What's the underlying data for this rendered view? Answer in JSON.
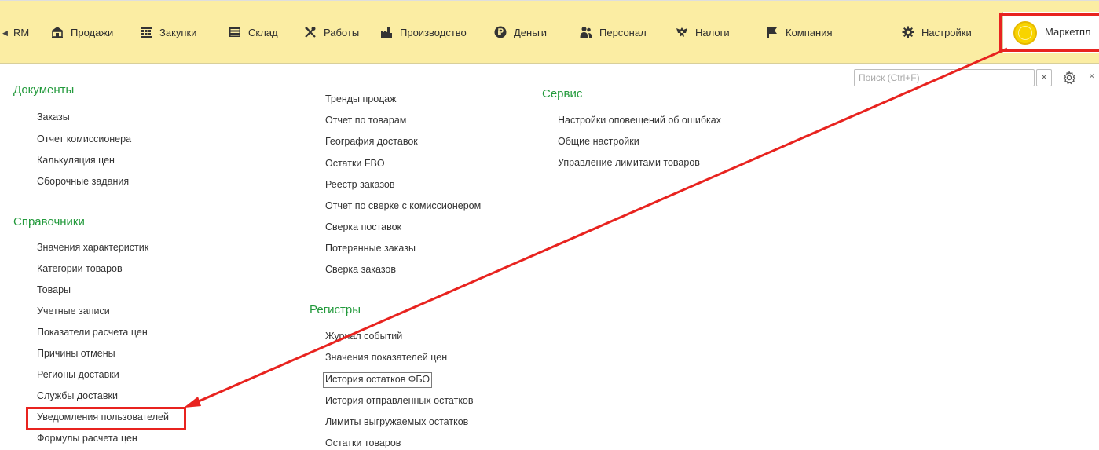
{
  "sections_bar": {
    "scroll_left_icon": "triangle-left-icon",
    "items": [
      {
        "label": "RM",
        "icon": ""
      },
      {
        "label": "Продажи",
        "icon": "shop-icon"
      },
      {
        "label": "Закупки",
        "icon": "cart-icon"
      },
      {
        "label": "Склад",
        "icon": "warehouse-icon"
      },
      {
        "label": "Работы",
        "icon": "tools-icon"
      },
      {
        "label": "Производство",
        "icon": "factory-icon"
      },
      {
        "label": "Деньги",
        "icon": "ruble-coin-icon"
      },
      {
        "label": "Персонал",
        "icon": "people-icon"
      },
      {
        "label": "Налоги",
        "icon": "eagle-emblem-icon"
      },
      {
        "label": "Компания",
        "icon": "flag-icon"
      },
      {
        "label": "Настройки",
        "icon": "gear-icon"
      }
    ],
    "marketplace": {
      "label": "Маркетпл",
      "icon": "yellow-circle-icon"
    }
  },
  "search": {
    "placeholder": "Поиск (Ctrl+F)",
    "value": "",
    "clear_label": "×"
  },
  "panel_close": "×",
  "columns": {
    "documents": {
      "title": "Документы",
      "items": [
        "Заказы",
        "Отчет комиссионера",
        "Калькуляция цен",
        "Сборочные задания"
      ]
    },
    "catalogs": {
      "title": "Справочники",
      "items": [
        "Значения характеристик",
        "Категории товаров",
        "Товары",
        "Учетные записи",
        "Показатели расчета цен",
        "Причины отмены",
        "Регионы доставки",
        "Службы доставки",
        "Уведомления пользователей",
        "Формулы расчета цен"
      ]
    },
    "reports": {
      "items": [
        "Тренды продаж",
        "Отчет по товарам",
        "География доставок",
        "Остатки FBO",
        "Реестр заказов",
        "Отчет по сверке с комиссионером",
        "Сверка поставок",
        "Потерянные заказы",
        "Сверка заказов"
      ]
    },
    "registers": {
      "title": "Регистры",
      "items": [
        "Журнал событий",
        "Значения показателей цен",
        "История остатков ФБО",
        "История отправленных остатков",
        "Лимиты выгружаемых остатков",
        "Остатки товаров"
      ]
    },
    "service": {
      "title": "Сервис",
      "items": [
        "Настройки оповещений об ошибках",
        "Общие настройки",
        "Управление лимитами товаров"
      ]
    }
  },
  "colors": {
    "topbar": "#fbeda3",
    "group_title": "#239a3c",
    "annotation": "#e8231f"
  }
}
